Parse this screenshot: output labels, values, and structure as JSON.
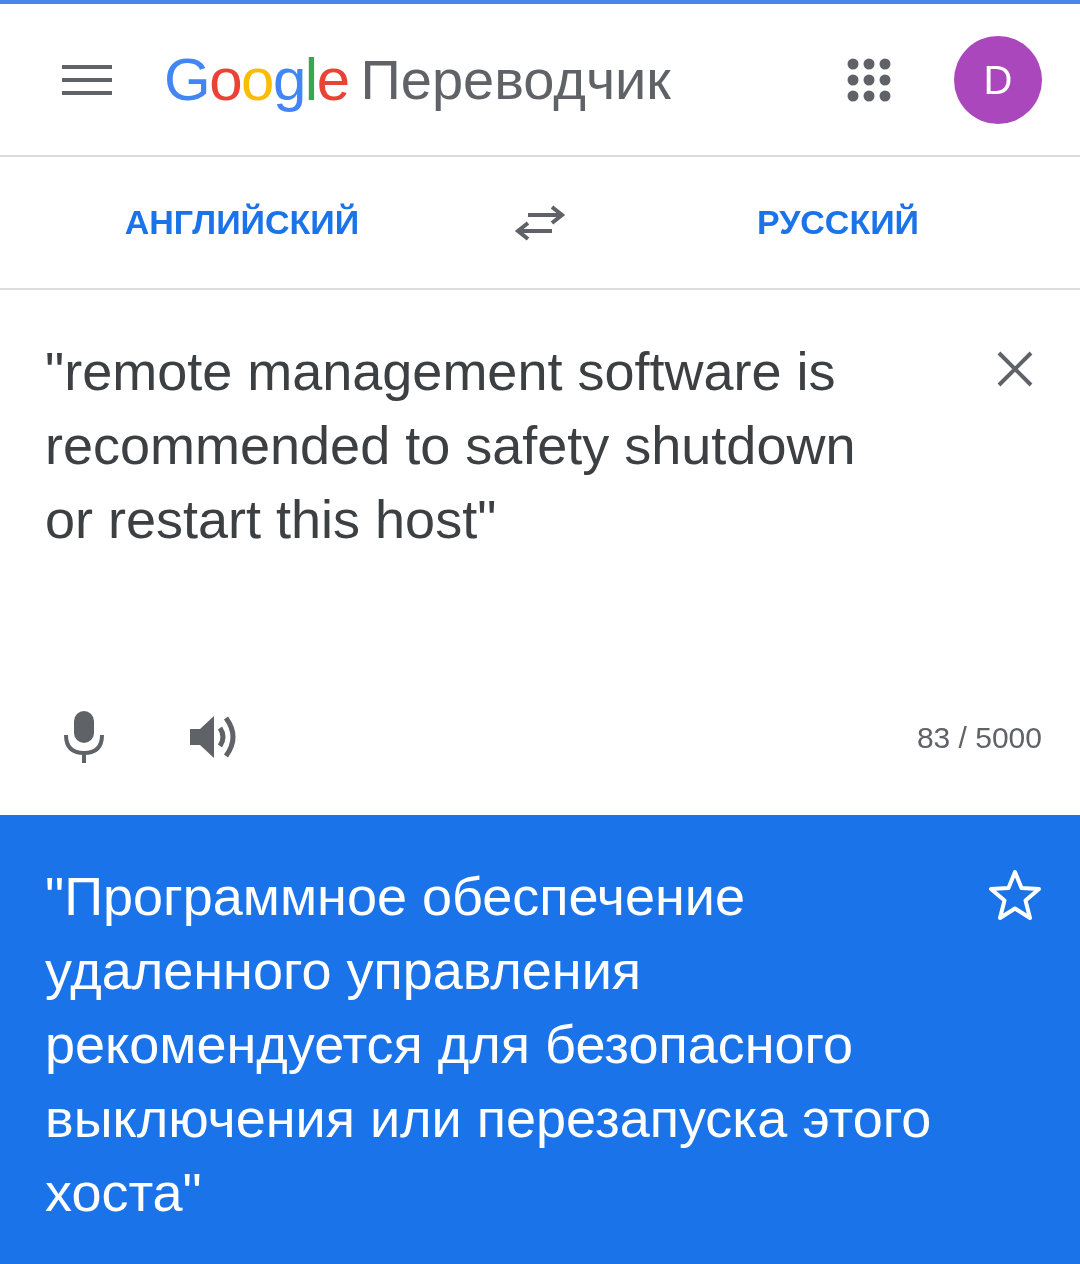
{
  "header": {
    "logo": "Google",
    "title": "Переводчик",
    "avatar": "D"
  },
  "languages": {
    "source": "АНГЛИЙСКИЙ",
    "target": "РУССКИЙ"
  },
  "input": {
    "value": "\"remote management software is recommended to safety shutdown or restart this host\"",
    "counter": "83 / 5000"
  },
  "output": {
    "text": "\"Программное обеспечение удаленного управления рекомендуется для безопасного выключения или перезапуска этого хоста\"",
    "starred": false
  }
}
